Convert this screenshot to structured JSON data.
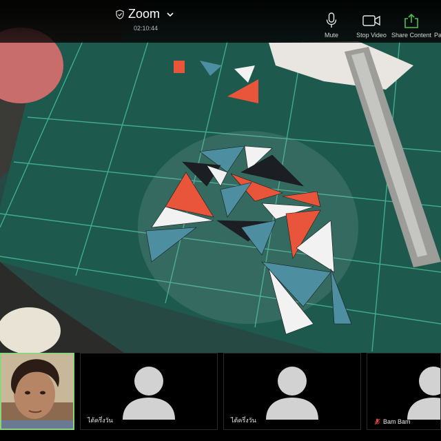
{
  "meeting": {
    "title": "Zoom",
    "elapsed": "02:10:44"
  },
  "toolbar": {
    "mute_label": "Mute",
    "stop_video_label": "Stop Video",
    "share_content_label": "Share Content",
    "participants_label": "Pa"
  },
  "colors": {
    "share_accent": "#4cc34a",
    "self_tile_border": "#8cd57c",
    "muted_indicator": "#e0453a"
  },
  "participants": [
    {
      "name": "",
      "is_self": true
    },
    {
      "name": "ไต้ครึ่งวัน"
    },
    {
      "name": "ไต้ครึ่งวัน"
    },
    {
      "name": "Bam Bam",
      "muted": true
    }
  ]
}
